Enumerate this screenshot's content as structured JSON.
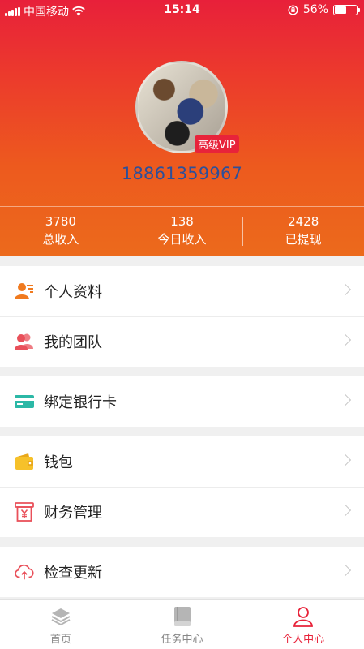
{
  "status_bar": {
    "carrier": "中国移动",
    "time": "15:14",
    "battery": "56%",
    "battery_level": 0.56
  },
  "profile": {
    "badge": "高级VIP",
    "phone": "18861359967"
  },
  "stats": [
    {
      "value": "3780",
      "label": "总收入"
    },
    {
      "value": "138",
      "label": "今日收入"
    },
    {
      "value": "2428",
      "label": "已提现"
    }
  ],
  "menu": {
    "personal_info": "个人资料",
    "my_team": "我的团队",
    "bind_card": "绑定银行卡",
    "wallet": "钱包",
    "finance": "财务管理",
    "check_update": "检查更新"
  },
  "tabs": [
    {
      "label": "首页",
      "icon": "layers-icon"
    },
    {
      "label": "任务中心",
      "icon": "book-icon"
    },
    {
      "label": "个人中心",
      "icon": "user-icon"
    }
  ],
  "colors": {
    "accent": "#e8233a",
    "header_top": "#e8203a",
    "header_bottom": "#ec6a1c",
    "phone_text": "#2d4f9a",
    "icon_orange": "#f07a1f",
    "icon_red": "#e9505a",
    "icon_teal": "#2bb8a6",
    "icon_yellow": "#f6c12a"
  }
}
